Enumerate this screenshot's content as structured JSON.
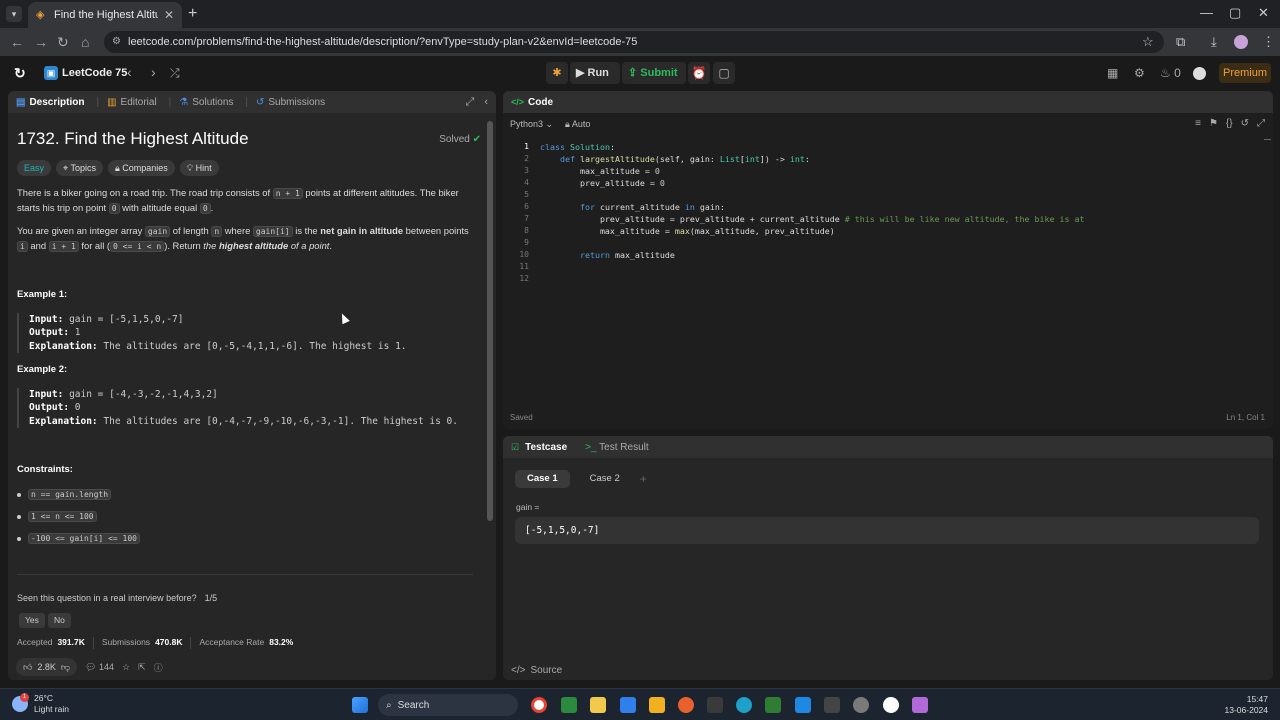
{
  "browser": {
    "tab_title": "Find the Highest Altitude - Leet",
    "url": "leetcode.com/problems/find-the-highest-altitude/description/?envType=study-plan-v2&envId=leetcode-75"
  },
  "nav": {
    "study_plan": "LeetCode 75",
    "run_label": "Run",
    "submit_label": "Submit",
    "streak": "0",
    "premium_label": "Premium"
  },
  "left_tabs": {
    "description": "Description",
    "editorial": "Editorial",
    "solutions": "Solutions",
    "submissions": "Submissions"
  },
  "problem": {
    "title": "1732. Find the Highest Altitude",
    "solved": "Solved",
    "difficulty": "Easy",
    "topics": "Topics",
    "companies": "Companies",
    "hint": "Hint",
    "p1_a": "There is a biker going on a road trip. The road trip consists of ",
    "p1_code1": "n + 1",
    "p1_b": " points at different altitudes. The biker starts his trip on point ",
    "p1_code2": "0",
    "p1_c": " with altitude equal ",
    "p1_code3": "0",
    "p1_d": ".",
    "p2_a": "You are given an integer array ",
    "p2_code1": "gain",
    "p2_b": " of length ",
    "p2_code2": "n",
    "p2_c": " where ",
    "p2_code3": "gain[i]",
    "p2_d": " is the ",
    "p2_bold": "net gain in altitude",
    "p2_e": " between points ",
    "p2_code4": "i",
    "p2_f": " and ",
    "p2_code5": "i + 1",
    "p2_g": " for all (",
    "p2_code6": "0 <= i < n",
    "p2_h": "). Return ",
    "p2_it1": "the ",
    "p2_bold2": "highest altitude",
    "p2_it2": " of a point",
    "p2_i": "."
  },
  "examples": [
    {
      "heading": "Example 1:",
      "input_label": "Input:",
      "input": "gain = [-5,1,5,0,-7]",
      "output_label": "Output:",
      "output": "1",
      "expl_label": "Explanation:",
      "expl": "The altitudes are [0,-5,-4,1,1,-6]. The highest is 1."
    },
    {
      "heading": "Example 2:",
      "input_label": "Input:",
      "input": "gain = [-4,-3,-2,-1,4,3,2]",
      "output_label": "Output:",
      "output": "0",
      "expl_label": "Explanation:",
      "expl": "The altitudes are [0,-4,-7,-9,-10,-6,-3,-1]. The highest is 0."
    }
  ],
  "constraints": {
    "heading": "Constraints:",
    "items": [
      "n == gain.length",
      "1 <= n <= 100",
      "-100 <= gain[i] <= 100"
    ]
  },
  "interview": {
    "question": "Seen this question in a real interview before?",
    "count": "1/5",
    "yes": "Yes",
    "no": "No"
  },
  "stats": {
    "accepted_label": "Accepted",
    "accepted": "391.7K",
    "submissions_label": "Submissions",
    "submissions": "470.8K",
    "rate_label": "Acceptance Rate",
    "rate": "83.2%"
  },
  "footer": {
    "likes": "2.8K",
    "comments": "144"
  },
  "code_panel": {
    "title": "Code",
    "language": "Python3",
    "auto": "Auto",
    "saved": "Saved",
    "position": "Ln 1, Col 1",
    "line_numbers": [
      "1",
      "2",
      "3",
      "4",
      "5",
      "6",
      "7",
      "8",
      "9",
      "10",
      "11",
      "12"
    ]
  },
  "testcase": {
    "tab": "Testcase",
    "result_tab": "Test Result",
    "case1": "Case 1",
    "case2": "Case 2",
    "var_label": "gain =",
    "var_value": "[-5,1,5,0,-7]",
    "source": "Source"
  },
  "taskbar": {
    "temp": "26°C",
    "weather": "Light rain",
    "notif": "1",
    "search": "Search",
    "time": "15:47",
    "date": "13-06-2024"
  }
}
